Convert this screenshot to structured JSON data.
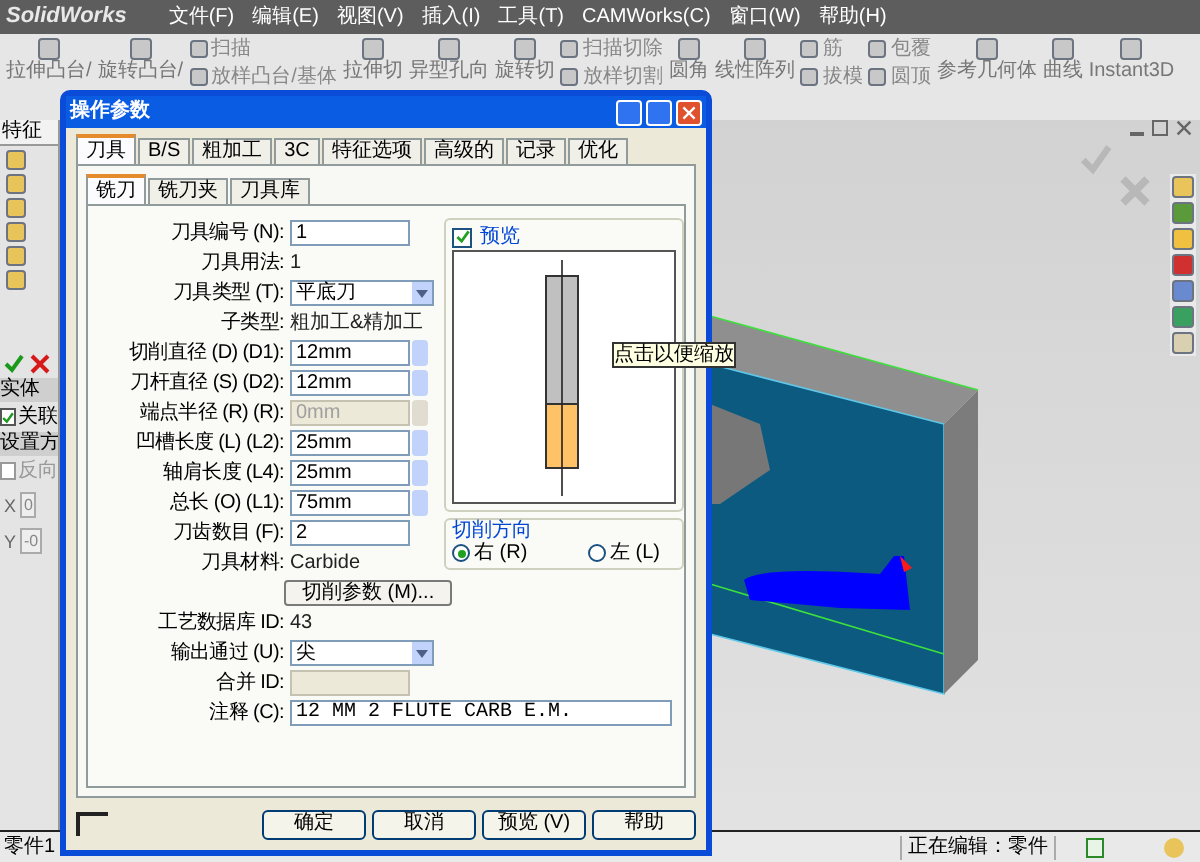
{
  "app": {
    "logo": "SolidWorks",
    "menu": [
      "文件(F)",
      "编辑(E)",
      "视图(V)",
      "插入(I)",
      "工具(T)",
      "CAMWorks(C)",
      "窗口(W)",
      "帮助(H)"
    ]
  },
  "toolbar": [
    {
      "kind": "large",
      "label": "拉伸凸台/"
    },
    {
      "kind": "large",
      "label": "旋转凸台/"
    },
    {
      "kind": "stack",
      "items": [
        "扫描",
        "放样凸台/基体"
      ]
    },
    {
      "kind": "large",
      "label": "拉伸切"
    },
    {
      "kind": "large",
      "label": "异型孔向"
    },
    {
      "kind": "large",
      "label": "旋转切"
    },
    {
      "kind": "stack",
      "items": [
        "扫描切除",
        "放样切割"
      ]
    },
    {
      "kind": "large",
      "label": "圆角"
    },
    {
      "kind": "large",
      "label": "线性阵列"
    },
    {
      "kind": "stack",
      "items": [
        "筋",
        "拔模"
      ]
    },
    {
      "kind": "stack",
      "items": [
        "包覆",
        "圆顶"
      ]
    },
    {
      "kind": "large",
      "label": "参考几何体"
    },
    {
      "kind": "large",
      "label": "曲线"
    },
    {
      "kind": "large",
      "label": "Instant3D"
    }
  ],
  "left_panel": {
    "tab": "特征",
    "group_1": "实体",
    "linked": {
      "label": "关联",
      "checked": true
    },
    "group_2": "设置方",
    "reverse": {
      "label": "反向",
      "checked": false
    },
    "axes": [
      {
        "label": "X",
        "value": "0"
      },
      {
        "label": "Y",
        "value": "-0"
      }
    ]
  },
  "dialog": {
    "title": "操作参数",
    "tabs": [
      {
        "label": "刀具",
        "selected": true
      },
      {
        "label": "B/S",
        "selected": false
      },
      {
        "label": "粗加工",
        "selected": false
      },
      {
        "label": "3C",
        "selected": false
      },
      {
        "label": "特征选项",
        "selected": false
      },
      {
        "label": "高级的",
        "selected": false
      },
      {
        "label": "记录",
        "selected": false
      },
      {
        "label": "优化",
        "selected": false
      }
    ],
    "subtabs": [
      {
        "label": "铣刀",
        "selected": true
      },
      {
        "label": "铣刀夹",
        "selected": false
      },
      {
        "label": "刀具库",
        "selected": false
      }
    ],
    "fields": [
      {
        "kind": "text",
        "label": "刀具编号 (N):",
        "value": "1",
        "disabled": false
      },
      {
        "kind": "static",
        "label": "刀具用法:",
        "value": "1"
      },
      {
        "kind": "select",
        "label": "刀具类型 (T):",
        "value": "平底刀",
        "disabled": false
      },
      {
        "kind": "static",
        "label": "子类型:",
        "value": "粗加工&精加工"
      },
      {
        "kind": "spin",
        "label": "切削直径 (D) (D1):",
        "value": "12mm",
        "disabled": false
      },
      {
        "kind": "spin",
        "label": "刀杆直径 (S) (D2):",
        "value": "12mm",
        "disabled": false
      },
      {
        "kind": "spin",
        "label": "端点半径 (R) (R):",
        "value": "0mm",
        "disabled": true
      },
      {
        "kind": "spin",
        "label": "凹槽长度 (L) (L2):",
        "value": "25mm",
        "disabled": false
      },
      {
        "kind": "spin",
        "label": "轴肩长度 (L4):",
        "value": "25mm",
        "disabled": false
      },
      {
        "kind": "spin",
        "label": "总长 (O) (L1):",
        "value": "75mm",
        "disabled": false
      },
      {
        "kind": "text",
        "label": "刀齿数目 (F):",
        "value": "2",
        "disabled": false
      },
      {
        "kind": "static",
        "label": "刀具材料:",
        "value": "Carbide"
      },
      {
        "kind": "button",
        "value": "切削参数 (M)..."
      }
    ],
    "preview": {
      "label": "预览",
      "checked": true,
      "tooltip": "点击以便缩放"
    },
    "direction": {
      "title": "切削方向",
      "options": [
        {
          "label": "右 (R)",
          "selected": true
        },
        {
          "label": "左 (L)",
          "selected": false
        }
      ]
    },
    "lower_fields": [
      {
        "kind": "static",
        "label": "工艺数据库 ID:",
        "value": "43"
      },
      {
        "kind": "select",
        "label": "输出通过 (U):",
        "value": "尖",
        "disabled": false
      },
      {
        "kind": "text",
        "label": "合并 ID:",
        "disabled": true
      },
      {
        "kind": "wide",
        "label": "注释 (C):",
        "value": "12 MM 2 FLUTE CARB E.M.",
        "disabled": false
      }
    ],
    "buttons": [
      "确定",
      "取消",
      "预览 (V)",
      "帮助"
    ]
  },
  "status_bar": {
    "left": "零件1",
    "mode": "正在编辑：零件"
  }
}
